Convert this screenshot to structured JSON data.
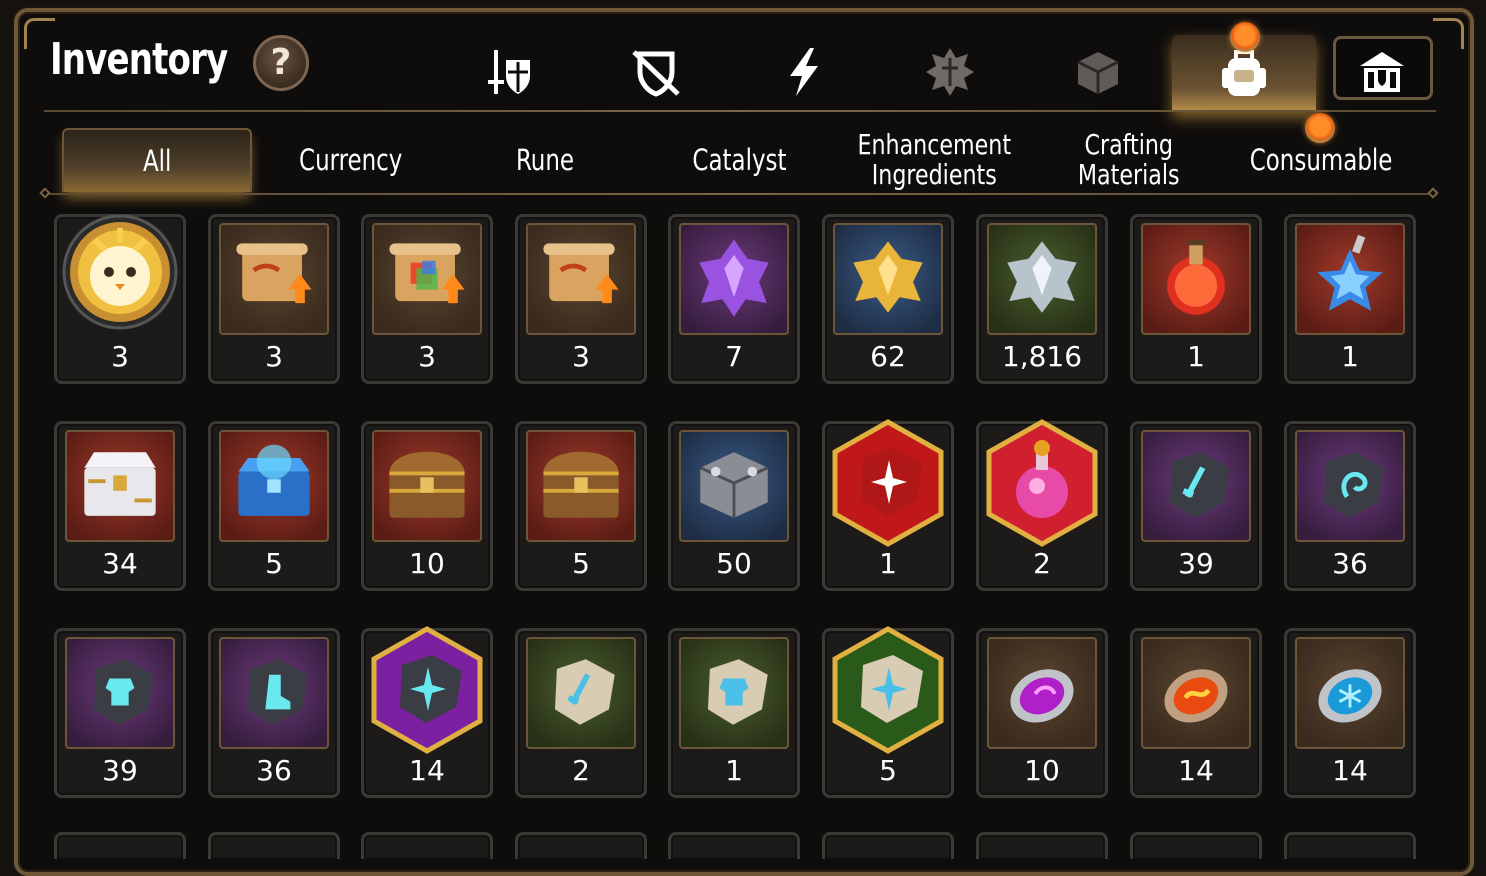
{
  "header": {
    "title": "Inventory",
    "help_label": "?"
  },
  "categories": [
    {
      "name": "gear",
      "icon": "sword-shield-icon",
      "active": false
    },
    {
      "name": "artifact",
      "icon": "broken-shield-icon",
      "active": false
    },
    {
      "name": "skill",
      "icon": "lightning-icon",
      "active": false
    },
    {
      "name": "rune",
      "icon": "cracked-rune-icon",
      "active": false
    },
    {
      "name": "material",
      "icon": "cube-icon",
      "active": false
    },
    {
      "name": "bag",
      "icon": "backpack-icon",
      "active": true
    },
    {
      "name": "guild",
      "icon": "castle-icon",
      "active": false
    }
  ],
  "subtabs": [
    {
      "label": "All",
      "active": true
    },
    {
      "label": "Currency",
      "active": false
    },
    {
      "label": "Rune",
      "active": false
    },
    {
      "label": "Catalyst",
      "active": false
    },
    {
      "label": "Enhancement\nIngredients",
      "active": false
    },
    {
      "label": "Crafting\nMaterials",
      "active": false
    },
    {
      "label": "Consumable",
      "active": false
    }
  ],
  "items": [
    {
      "count": "3",
      "icon": "chick-emblem-icon"
    },
    {
      "count": "3",
      "icon": "scroll-upgrade-icon"
    },
    {
      "count": "3",
      "icon": "rainbow-scroll-upgrade-icon"
    },
    {
      "count": "3",
      "icon": "scroll-upgrade-icon"
    },
    {
      "count": "7",
      "icon": "purple-crystal-icon"
    },
    {
      "count": "62",
      "icon": "gold-crystal-icon"
    },
    {
      "count": "1,816",
      "icon": "silver-crystal-icon"
    },
    {
      "count": "1",
      "icon": "red-potion-icon"
    },
    {
      "count": "1",
      "icon": "star-potion-icon"
    },
    {
      "count": "34",
      "icon": "white-chest-icon"
    },
    {
      "count": "5",
      "icon": "blue-chest-icon"
    },
    {
      "count": "10",
      "icon": "treasure-chest-icon"
    },
    {
      "count": "5",
      "icon": "treasure-chest-icon"
    },
    {
      "count": "50",
      "icon": "silver-cube-icon"
    },
    {
      "count": "1",
      "icon": "red-rune-stone-icon"
    },
    {
      "count": "2",
      "icon": "pink-potion-icon"
    },
    {
      "count": "39",
      "icon": "sword-rune-stone-icon"
    },
    {
      "count": "36",
      "icon": "swirl-rune-stone-icon"
    },
    {
      "count": "39",
      "icon": "armor-rune-stone-icon"
    },
    {
      "count": "36",
      "icon": "boot-rune-stone-icon"
    },
    {
      "count": "14",
      "icon": "star-rune-stone-icon"
    },
    {
      "count": "2",
      "icon": "sword-rune-tablet-icon"
    },
    {
      "count": "1",
      "icon": "armor-rune-tablet-icon"
    },
    {
      "count": "5",
      "icon": "star-rune-tablet-icon"
    },
    {
      "count": "10",
      "icon": "purple-gem-icon"
    },
    {
      "count": "14",
      "icon": "fire-gem-icon"
    },
    {
      "count": "14",
      "icon": "ice-gem-icon"
    }
  ],
  "colors": {
    "frame": "#6f5837",
    "accent_gold": "#b98e4a",
    "notify": "#e85a0f"
  }
}
